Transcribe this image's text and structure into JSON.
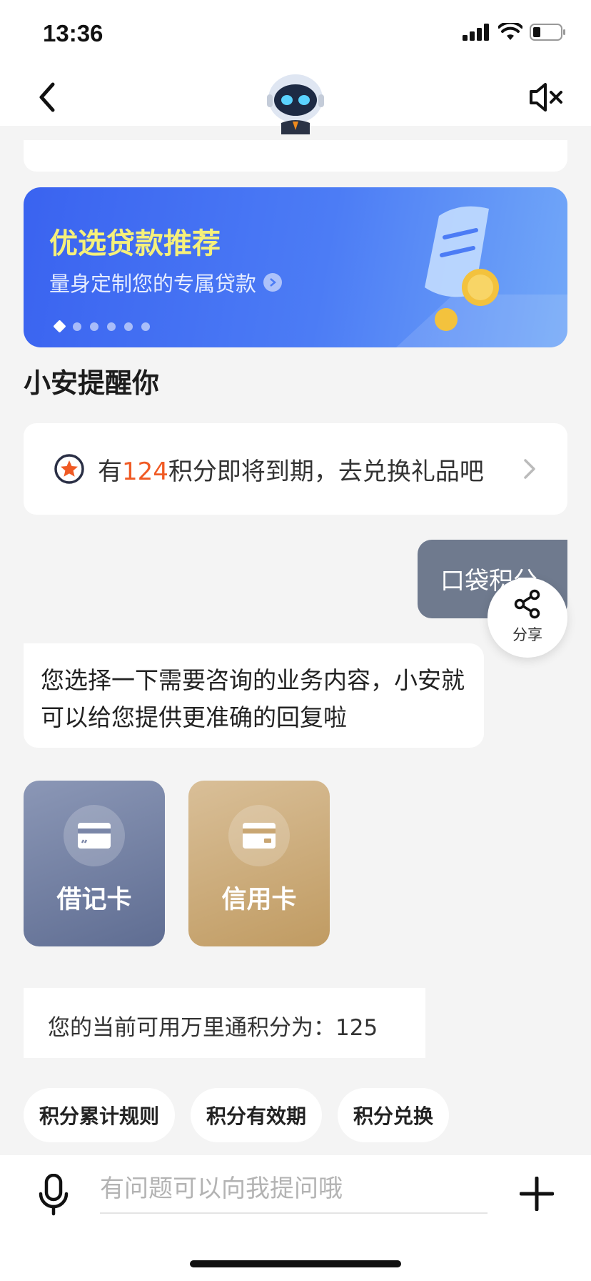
{
  "status_bar": {
    "time": "13:36"
  },
  "banner": {
    "title": "优选贷款推荐",
    "subtitle": "量身定制您的专属贷款",
    "slide_count": 6,
    "active_slide": 1
  },
  "reminder_section": {
    "title": "小安提醒你",
    "reminder_prefix": "有",
    "reminder_points": "124",
    "reminder_suffix": "积分即将到期，去兑换礼品吧"
  },
  "chat": {
    "user_message": "口袋积分",
    "share_label": "分享",
    "bot_message": "您选择一下需要咨询的业务内容，小安就可以给您提供更准确的回复啦",
    "options": [
      {
        "label": "借记卡"
      },
      {
        "label": "信用卡"
      }
    ],
    "points_message": "您的当前可用万里通积分为：125"
  },
  "quick_replies": [
    "积分累计规则",
    "积分有效期",
    "积分兑换"
  ],
  "input_bar": {
    "placeholder": "有问题可以向我提问哦"
  },
  "colors": {
    "accent_orange": "#f05a24",
    "banner_title": "#f5f07a",
    "user_bubble": "#6f7a8e",
    "debit_card": "#6f7ca0",
    "credit_card": "#c9a672"
  }
}
